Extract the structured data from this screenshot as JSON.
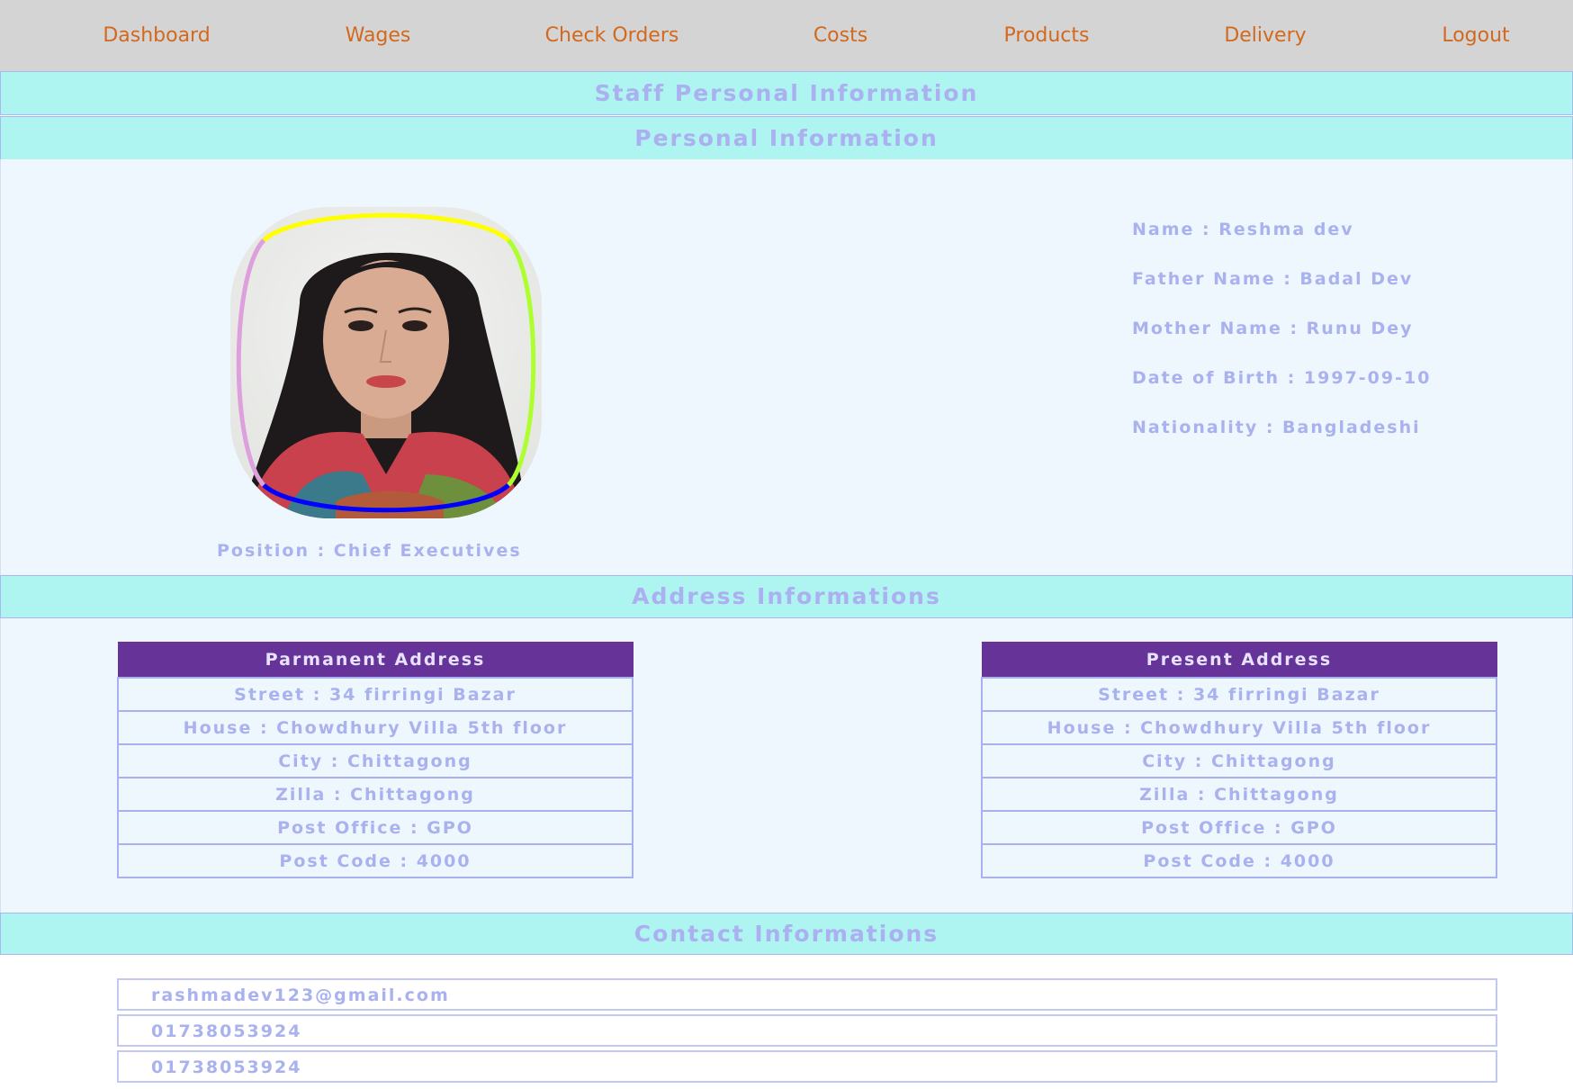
{
  "nav": {
    "items": [
      {
        "label": "Dashboard"
      },
      {
        "label": "Wages"
      },
      {
        "label": "Check Orders"
      },
      {
        "label": "Costs"
      },
      {
        "label": "Products"
      },
      {
        "label": "Delivery"
      },
      {
        "label": "Logout"
      }
    ]
  },
  "page": {
    "title": "Staff Personal Information"
  },
  "personal": {
    "heading": "Personal Information",
    "position": "Position : Chief Executives",
    "fields": [
      "Name : Reshma dev",
      "Father Name : Badal Dev",
      "Mother Name : Runu Dey",
      "Date of Birth : 1997-09-10",
      "Nationality : Bangladeshi"
    ]
  },
  "address": {
    "heading": "Address Informations",
    "permanent": {
      "title": "Parmanent Address",
      "rows": [
        "Street : 34 firringi Bazar",
        "House : Chowdhury Villa 5th floor",
        "City : Chittagong",
        "Zilla : Chittagong",
        "Post Office : GPO",
        "Post Code : 4000"
      ]
    },
    "present": {
      "title": "Present Address",
      "rows": [
        "Street : 34 firringi Bazar",
        "House : Chowdhury Villa 5th floor",
        "City : Chittagong",
        "Zilla : Chittagong",
        "Post Office : GPO",
        "Post Code : 4000"
      ]
    }
  },
  "contact": {
    "heading": "Contact Informations",
    "items": [
      "rashmadev123@gmail.com",
      "01738053924",
      "01738053924"
    ]
  },
  "colors": {
    "nav_bg": "#d4d4d4",
    "nav_text": "#d2691e",
    "banner_bg": "#aef4f0",
    "banner_text": "#aab0f0",
    "table_header_bg": "#663399",
    "body_text": "#a9b2ee",
    "photo_ring": [
      "#ffff00",
      "#adff2f",
      "#0000ff",
      "#dda0dd"
    ]
  }
}
